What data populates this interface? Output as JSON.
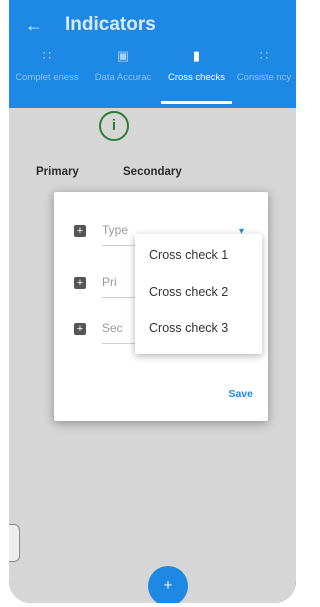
{
  "appbar": {
    "back_icon": "arrow-left-icon",
    "title": "Indicators"
  },
  "tabs": [
    {
      "label": "Complet eness",
      "icon": "grid-icon",
      "active": false
    },
    {
      "label": "Data Accurac",
      "icon": "laptop-icon",
      "active": false
    },
    {
      "label": "Cross checks",
      "icon": "book-icon",
      "active": true
    },
    {
      "label": "Consiste ncy",
      "icon": "grid-icon",
      "active": false
    }
  ],
  "content": {
    "info_icon": "info-icon",
    "info_glyph": "i",
    "col_primary": "Primary",
    "col_secondary": "Secondary"
  },
  "dialog": {
    "fields": [
      {
        "label": "Type"
      },
      {
        "label": "Pri"
      },
      {
        "label": "Sec"
      }
    ],
    "save_label": "Save"
  },
  "dropdown": {
    "options": [
      "Cross check 1",
      "Cross check 2",
      "Cross check 3"
    ]
  },
  "fab": {
    "icon": "plus-icon",
    "glyph": "+"
  },
  "colors": {
    "primary": "#1e88e5",
    "info_green": "#2e7d32"
  }
}
